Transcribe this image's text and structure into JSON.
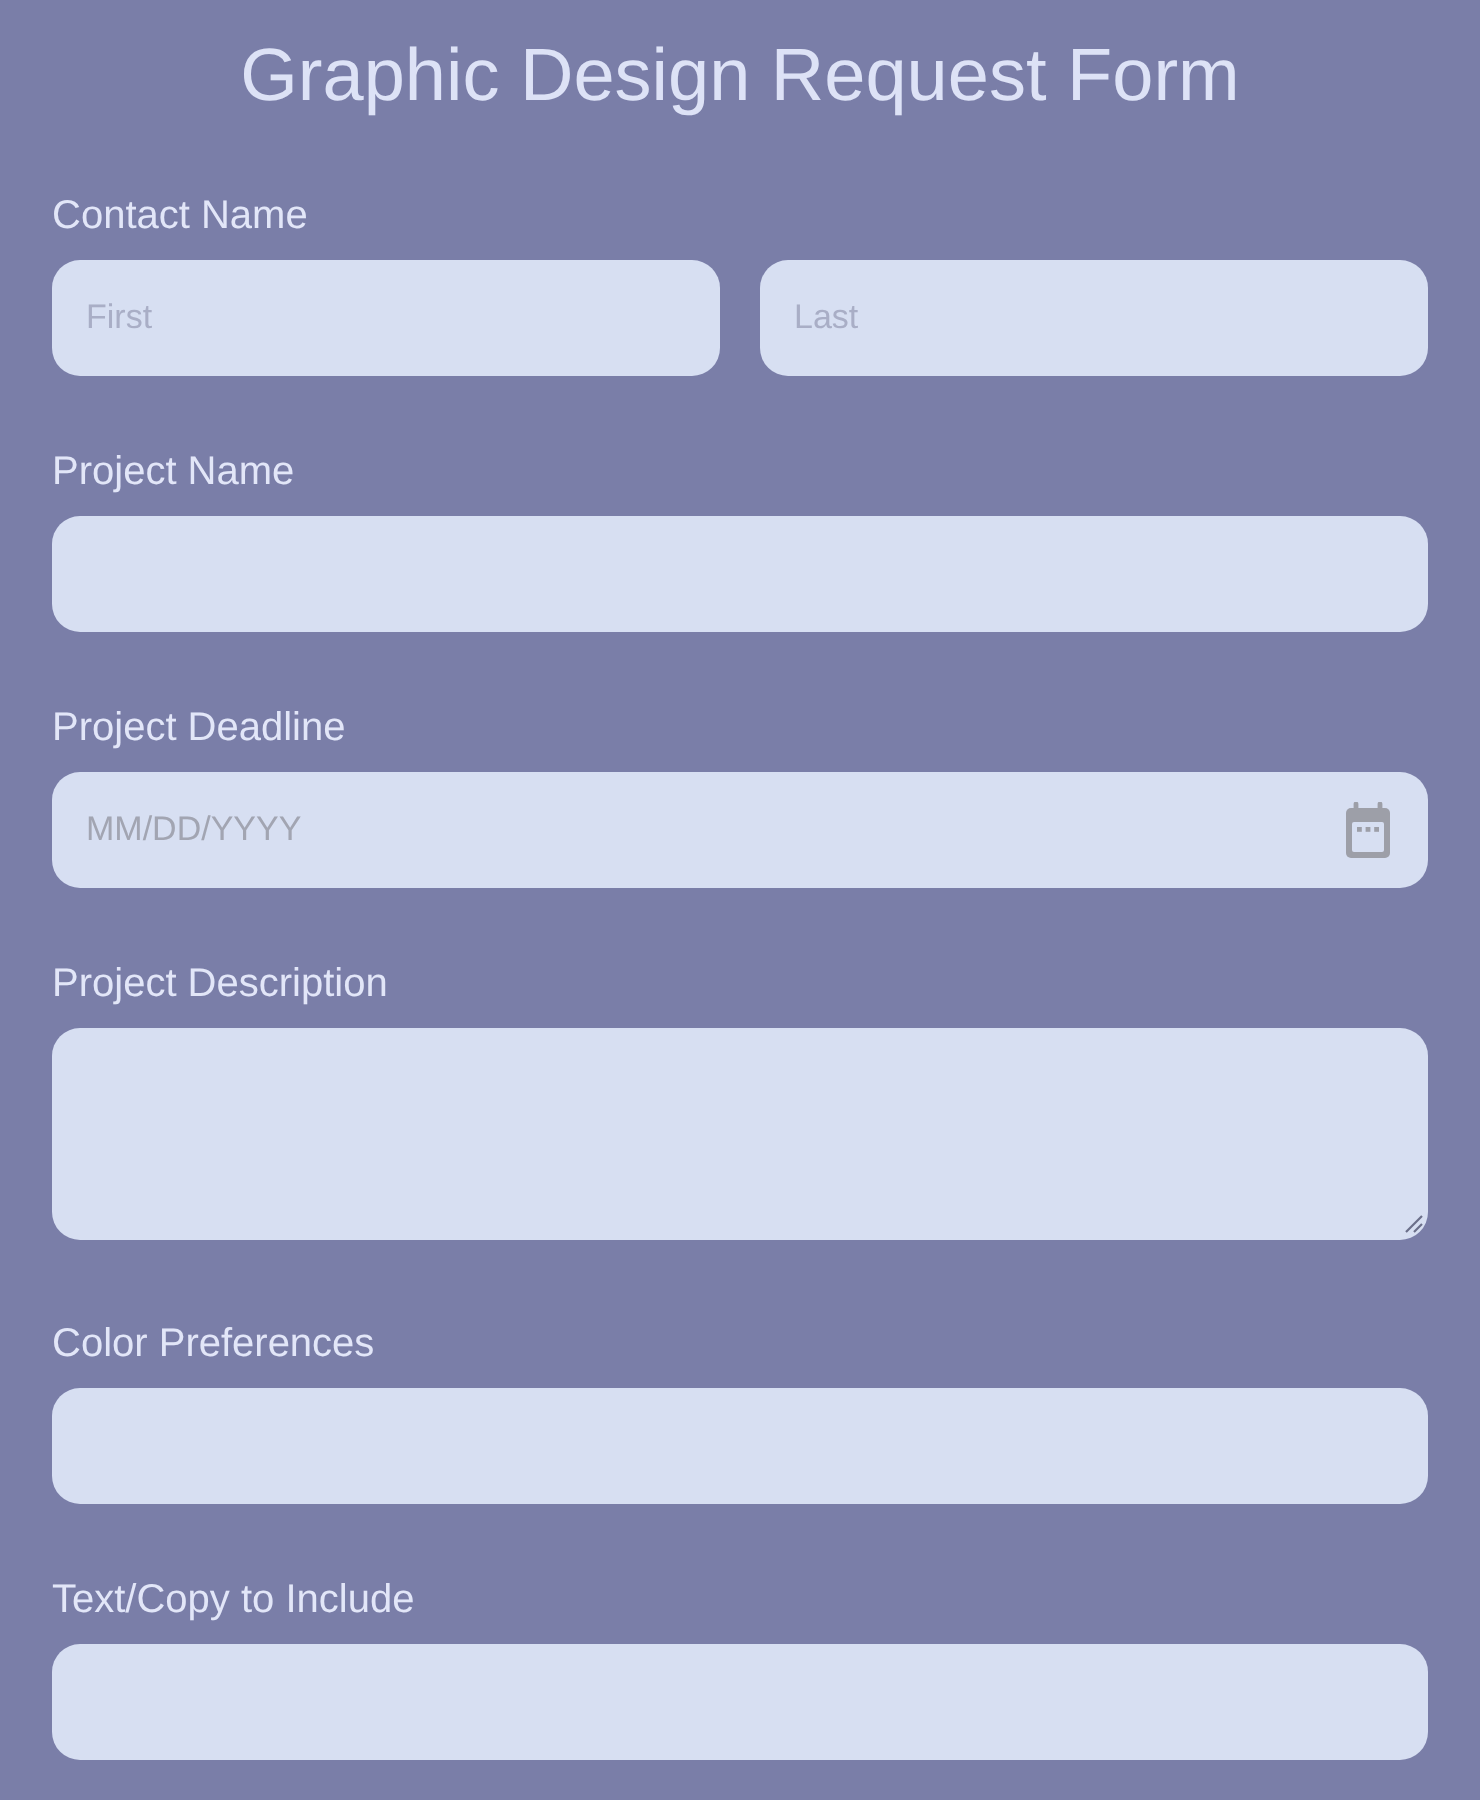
{
  "title": "Graphic Design Request Form",
  "fields": [
    {
      "label": "Contact Name",
      "kind": "name_pair",
      "inputs": [
        {
          "placeholder": "First"
        },
        {
          "placeholder": "Last"
        }
      ]
    },
    {
      "label": "Project Name",
      "kind": "text"
    },
    {
      "label": "Project Deadline",
      "kind": "date",
      "placeholder": "MM/DD/YYYY"
    },
    {
      "label": "Project Description",
      "kind": "textarea"
    },
    {
      "label": "Color Preferences",
      "kind": "text"
    },
    {
      "label": "Text/Copy to Include",
      "kind": "text"
    }
  ]
}
